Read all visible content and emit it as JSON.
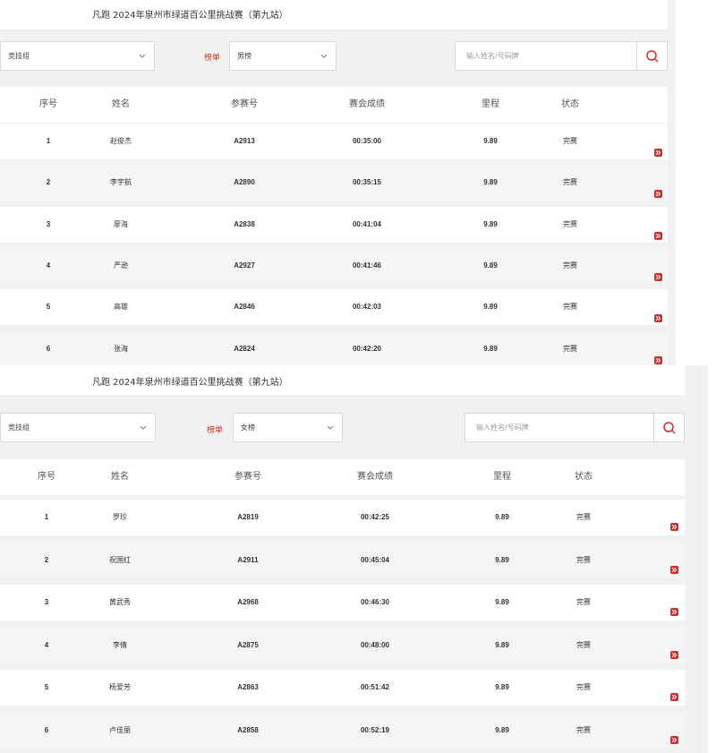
{
  "panels": [
    {
      "title": "凡跑 2024年泉州市绿道百公里挑战赛（第九站）",
      "group_select": "竞技组",
      "rank_label": "榜单",
      "rank_select": "男榜",
      "search_placeholder": "输入姓名/号码牌",
      "headers": [
        "序号",
        "姓名",
        "参赛号",
        "赛会成绩",
        "里程",
        "状态"
      ],
      "rows": [
        {
          "rank": "1",
          "name": "赵俊杰",
          "bib": "A2913",
          "time": "00:35:00",
          "distance": "9.89",
          "status": "完赛"
        },
        {
          "rank": "2",
          "name": "李宇航",
          "bib": "A2890",
          "time": "00:35:15",
          "distance": "9.89",
          "status": "完赛"
        },
        {
          "rank": "3",
          "name": "廖海",
          "bib": "A2838",
          "time": "00:41:04",
          "distance": "9.89",
          "status": "完赛"
        },
        {
          "rank": "4",
          "name": "严逊",
          "bib": "A2927",
          "time": "00:41:46",
          "distance": "9.89",
          "status": "完赛"
        },
        {
          "rank": "5",
          "name": "高雄",
          "bib": "A2846",
          "time": "00:42:03",
          "distance": "9.89",
          "status": "完赛"
        },
        {
          "rank": "6",
          "name": "张海",
          "bib": "A2824",
          "time": "00:42:20",
          "distance": "9.89",
          "status": "完赛"
        }
      ]
    },
    {
      "title": "凡跑 2024年泉州市绿道百公里挑战赛（第九站）",
      "group_select": "竞技组",
      "rank_label": "榜单",
      "rank_select": "女榜",
      "search_placeholder": "输入姓名/号码牌",
      "headers": [
        "序号",
        "姓名",
        "参赛号",
        "赛会成绩",
        "里程",
        "状态"
      ],
      "rows": [
        {
          "rank": "1",
          "name": "罗珍",
          "bib": "A2819",
          "time": "00:42:25",
          "distance": "9.89",
          "status": "完赛"
        },
        {
          "rank": "2",
          "name": "祝国红",
          "bib": "A2911",
          "time": "00:45:04",
          "distance": "9.89",
          "status": "完赛"
        },
        {
          "rank": "3",
          "name": "黄武秀",
          "bib": "A2968",
          "time": "00:46:30",
          "distance": "9.89",
          "status": "完赛"
        },
        {
          "rank": "4",
          "name": "李倩",
          "bib": "A2875",
          "time": "00:48:00",
          "distance": "9.89",
          "status": "完赛"
        },
        {
          "rank": "5",
          "name": "杨爱芳",
          "bib": "A2863",
          "time": "00:51:42",
          "distance": "9.89",
          "status": "完赛"
        },
        {
          "rank": "6",
          "name": "卢佳丽",
          "bib": "A2858",
          "time": "00:52:19",
          "distance": "9.89",
          "status": "完赛"
        }
      ]
    }
  ],
  "colors": {
    "accent": "#c9302c",
    "label_red": "#c0392b",
    "panel_bg": "#f1f1f1"
  },
  "icons": {
    "search": "search-icon",
    "dropdown": "chevron-down-icon",
    "detail": "double-chevron-right-icon"
  }
}
